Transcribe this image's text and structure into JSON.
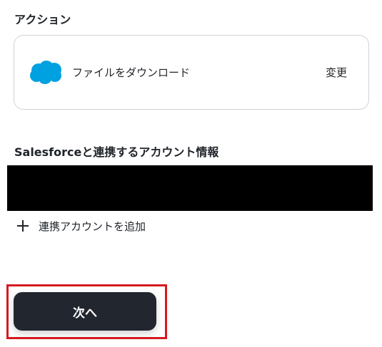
{
  "action_section": {
    "label": "アクション",
    "card": {
      "icon": "salesforce-cloud-icon",
      "icon_color": "#00a1e0",
      "action_name": "ファイルをダウンロード",
      "change_label": "変更"
    }
  },
  "account_section": {
    "label": "Salesforceと連携するアカウント情報",
    "add_account_icon": "plus-icon",
    "add_account_label": "連携アカウントを追加"
  },
  "footer": {
    "next_label": "次へ",
    "highlight_color": "#d7191f",
    "button_color": "#22262f"
  }
}
